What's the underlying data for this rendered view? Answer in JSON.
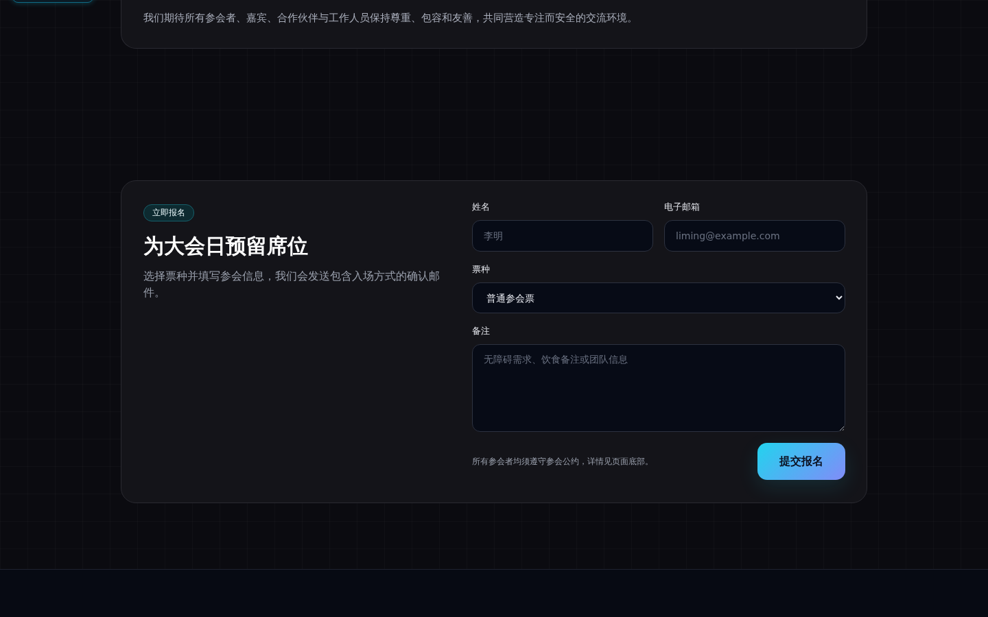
{
  "conduct": {
    "text": "我们期待所有参会者、嘉宾、合作伙伴与工作人员保持尊重、包容和友善，共同营造专注而安全的交流环境。"
  },
  "signup": {
    "badge": "立即报名",
    "title": "为大会日预留席位",
    "description": "选择票种并填写参会信息，我们会发送包含入场方式的确认邮件。",
    "fields": [
      {
        "kind": "input",
        "label": "姓名",
        "placeholder": "李明"
      },
      {
        "kind": "input",
        "label": "电子邮箱",
        "placeholder": "liming@example.com"
      },
      {
        "kind": "select",
        "label": "票种",
        "value": "普通参会票"
      },
      {
        "kind": "textarea",
        "label": "备注",
        "placeholder": "无障碍需求、饮食备注或团队信息"
      }
    ],
    "note": "所有参会者均须遵守参会公约，详情见页面底部。",
    "submit": "提交报名"
  }
}
